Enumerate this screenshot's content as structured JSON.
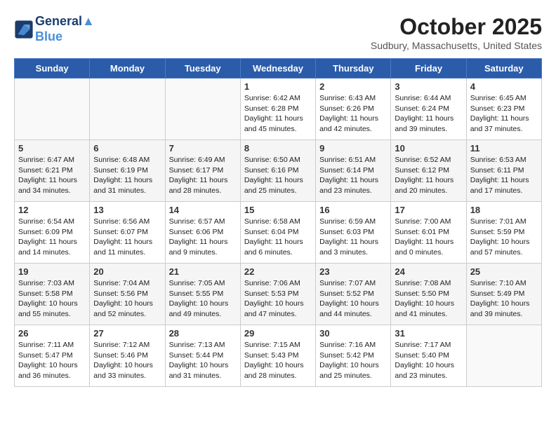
{
  "logo": {
    "line1": "General",
    "line2": "Blue"
  },
  "title": "October 2025",
  "subtitle": "Sudbury, Massachusetts, United States",
  "days_of_week": [
    "Sunday",
    "Monday",
    "Tuesday",
    "Wednesday",
    "Thursday",
    "Friday",
    "Saturday"
  ],
  "weeks": [
    [
      {
        "day": "",
        "info": ""
      },
      {
        "day": "",
        "info": ""
      },
      {
        "day": "",
        "info": ""
      },
      {
        "day": "1",
        "info": "Sunrise: 6:42 AM\nSunset: 6:28 PM\nDaylight: 11 hours and 45 minutes."
      },
      {
        "day": "2",
        "info": "Sunrise: 6:43 AM\nSunset: 6:26 PM\nDaylight: 11 hours and 42 minutes."
      },
      {
        "day": "3",
        "info": "Sunrise: 6:44 AM\nSunset: 6:24 PM\nDaylight: 11 hours and 39 minutes."
      },
      {
        "day": "4",
        "info": "Sunrise: 6:45 AM\nSunset: 6:23 PM\nDaylight: 11 hours and 37 minutes."
      }
    ],
    [
      {
        "day": "5",
        "info": "Sunrise: 6:47 AM\nSunset: 6:21 PM\nDaylight: 11 hours and 34 minutes."
      },
      {
        "day": "6",
        "info": "Sunrise: 6:48 AM\nSunset: 6:19 PM\nDaylight: 11 hours and 31 minutes."
      },
      {
        "day": "7",
        "info": "Sunrise: 6:49 AM\nSunset: 6:17 PM\nDaylight: 11 hours and 28 minutes."
      },
      {
        "day": "8",
        "info": "Sunrise: 6:50 AM\nSunset: 6:16 PM\nDaylight: 11 hours and 25 minutes."
      },
      {
        "day": "9",
        "info": "Sunrise: 6:51 AM\nSunset: 6:14 PM\nDaylight: 11 hours and 23 minutes."
      },
      {
        "day": "10",
        "info": "Sunrise: 6:52 AM\nSunset: 6:12 PM\nDaylight: 11 hours and 20 minutes."
      },
      {
        "day": "11",
        "info": "Sunrise: 6:53 AM\nSunset: 6:11 PM\nDaylight: 11 hours and 17 minutes."
      }
    ],
    [
      {
        "day": "12",
        "info": "Sunrise: 6:54 AM\nSunset: 6:09 PM\nDaylight: 11 hours and 14 minutes."
      },
      {
        "day": "13",
        "info": "Sunrise: 6:56 AM\nSunset: 6:07 PM\nDaylight: 11 hours and 11 minutes."
      },
      {
        "day": "14",
        "info": "Sunrise: 6:57 AM\nSunset: 6:06 PM\nDaylight: 11 hours and 9 minutes."
      },
      {
        "day": "15",
        "info": "Sunrise: 6:58 AM\nSunset: 6:04 PM\nDaylight: 11 hours and 6 minutes."
      },
      {
        "day": "16",
        "info": "Sunrise: 6:59 AM\nSunset: 6:03 PM\nDaylight: 11 hours and 3 minutes."
      },
      {
        "day": "17",
        "info": "Sunrise: 7:00 AM\nSunset: 6:01 PM\nDaylight: 11 hours and 0 minutes."
      },
      {
        "day": "18",
        "info": "Sunrise: 7:01 AM\nSunset: 5:59 PM\nDaylight: 10 hours and 57 minutes."
      }
    ],
    [
      {
        "day": "19",
        "info": "Sunrise: 7:03 AM\nSunset: 5:58 PM\nDaylight: 10 hours and 55 minutes."
      },
      {
        "day": "20",
        "info": "Sunrise: 7:04 AM\nSunset: 5:56 PM\nDaylight: 10 hours and 52 minutes."
      },
      {
        "day": "21",
        "info": "Sunrise: 7:05 AM\nSunset: 5:55 PM\nDaylight: 10 hours and 49 minutes."
      },
      {
        "day": "22",
        "info": "Sunrise: 7:06 AM\nSunset: 5:53 PM\nDaylight: 10 hours and 47 minutes."
      },
      {
        "day": "23",
        "info": "Sunrise: 7:07 AM\nSunset: 5:52 PM\nDaylight: 10 hours and 44 minutes."
      },
      {
        "day": "24",
        "info": "Sunrise: 7:08 AM\nSunset: 5:50 PM\nDaylight: 10 hours and 41 minutes."
      },
      {
        "day": "25",
        "info": "Sunrise: 7:10 AM\nSunset: 5:49 PM\nDaylight: 10 hours and 39 minutes."
      }
    ],
    [
      {
        "day": "26",
        "info": "Sunrise: 7:11 AM\nSunset: 5:47 PM\nDaylight: 10 hours and 36 minutes."
      },
      {
        "day": "27",
        "info": "Sunrise: 7:12 AM\nSunset: 5:46 PM\nDaylight: 10 hours and 33 minutes."
      },
      {
        "day": "28",
        "info": "Sunrise: 7:13 AM\nSunset: 5:44 PM\nDaylight: 10 hours and 31 minutes."
      },
      {
        "day": "29",
        "info": "Sunrise: 7:15 AM\nSunset: 5:43 PM\nDaylight: 10 hours and 28 minutes."
      },
      {
        "day": "30",
        "info": "Sunrise: 7:16 AM\nSunset: 5:42 PM\nDaylight: 10 hours and 25 minutes."
      },
      {
        "day": "31",
        "info": "Sunrise: 7:17 AM\nSunset: 5:40 PM\nDaylight: 10 hours and 23 minutes."
      },
      {
        "day": "",
        "info": ""
      }
    ]
  ]
}
